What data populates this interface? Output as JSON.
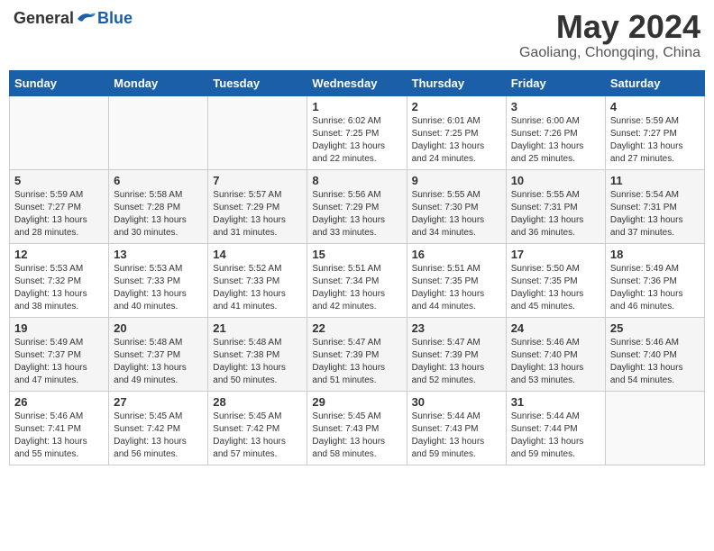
{
  "header": {
    "logo_general": "General",
    "logo_blue": "Blue",
    "month_title": "May 2024",
    "location": "Gaoliang, Chongqing, China"
  },
  "weekdays": [
    "Sunday",
    "Monday",
    "Tuesday",
    "Wednesday",
    "Thursday",
    "Friday",
    "Saturday"
  ],
  "weeks": [
    [
      {
        "day": "",
        "info": ""
      },
      {
        "day": "",
        "info": ""
      },
      {
        "day": "",
        "info": ""
      },
      {
        "day": "1",
        "info": "Sunrise: 6:02 AM\nSunset: 7:25 PM\nDaylight: 13 hours\nand 22 minutes."
      },
      {
        "day": "2",
        "info": "Sunrise: 6:01 AM\nSunset: 7:25 PM\nDaylight: 13 hours\nand 24 minutes."
      },
      {
        "day": "3",
        "info": "Sunrise: 6:00 AM\nSunset: 7:26 PM\nDaylight: 13 hours\nand 25 minutes."
      },
      {
        "day": "4",
        "info": "Sunrise: 5:59 AM\nSunset: 7:27 PM\nDaylight: 13 hours\nand 27 minutes."
      }
    ],
    [
      {
        "day": "5",
        "info": "Sunrise: 5:59 AM\nSunset: 7:27 PM\nDaylight: 13 hours\nand 28 minutes."
      },
      {
        "day": "6",
        "info": "Sunrise: 5:58 AM\nSunset: 7:28 PM\nDaylight: 13 hours\nand 30 minutes."
      },
      {
        "day": "7",
        "info": "Sunrise: 5:57 AM\nSunset: 7:29 PM\nDaylight: 13 hours\nand 31 minutes."
      },
      {
        "day": "8",
        "info": "Sunrise: 5:56 AM\nSunset: 7:29 PM\nDaylight: 13 hours\nand 33 minutes."
      },
      {
        "day": "9",
        "info": "Sunrise: 5:55 AM\nSunset: 7:30 PM\nDaylight: 13 hours\nand 34 minutes."
      },
      {
        "day": "10",
        "info": "Sunrise: 5:55 AM\nSunset: 7:31 PM\nDaylight: 13 hours\nand 36 minutes."
      },
      {
        "day": "11",
        "info": "Sunrise: 5:54 AM\nSunset: 7:31 PM\nDaylight: 13 hours\nand 37 minutes."
      }
    ],
    [
      {
        "day": "12",
        "info": "Sunrise: 5:53 AM\nSunset: 7:32 PM\nDaylight: 13 hours\nand 38 minutes."
      },
      {
        "day": "13",
        "info": "Sunrise: 5:53 AM\nSunset: 7:33 PM\nDaylight: 13 hours\nand 40 minutes."
      },
      {
        "day": "14",
        "info": "Sunrise: 5:52 AM\nSunset: 7:33 PM\nDaylight: 13 hours\nand 41 minutes."
      },
      {
        "day": "15",
        "info": "Sunrise: 5:51 AM\nSunset: 7:34 PM\nDaylight: 13 hours\nand 42 minutes."
      },
      {
        "day": "16",
        "info": "Sunrise: 5:51 AM\nSunset: 7:35 PM\nDaylight: 13 hours\nand 44 minutes."
      },
      {
        "day": "17",
        "info": "Sunrise: 5:50 AM\nSunset: 7:35 PM\nDaylight: 13 hours\nand 45 minutes."
      },
      {
        "day": "18",
        "info": "Sunrise: 5:49 AM\nSunset: 7:36 PM\nDaylight: 13 hours\nand 46 minutes."
      }
    ],
    [
      {
        "day": "19",
        "info": "Sunrise: 5:49 AM\nSunset: 7:37 PM\nDaylight: 13 hours\nand 47 minutes."
      },
      {
        "day": "20",
        "info": "Sunrise: 5:48 AM\nSunset: 7:37 PM\nDaylight: 13 hours\nand 49 minutes."
      },
      {
        "day": "21",
        "info": "Sunrise: 5:48 AM\nSunset: 7:38 PM\nDaylight: 13 hours\nand 50 minutes."
      },
      {
        "day": "22",
        "info": "Sunrise: 5:47 AM\nSunset: 7:39 PM\nDaylight: 13 hours\nand 51 minutes."
      },
      {
        "day": "23",
        "info": "Sunrise: 5:47 AM\nSunset: 7:39 PM\nDaylight: 13 hours\nand 52 minutes."
      },
      {
        "day": "24",
        "info": "Sunrise: 5:46 AM\nSunset: 7:40 PM\nDaylight: 13 hours\nand 53 minutes."
      },
      {
        "day": "25",
        "info": "Sunrise: 5:46 AM\nSunset: 7:40 PM\nDaylight: 13 hours\nand 54 minutes."
      }
    ],
    [
      {
        "day": "26",
        "info": "Sunrise: 5:46 AM\nSunset: 7:41 PM\nDaylight: 13 hours\nand 55 minutes."
      },
      {
        "day": "27",
        "info": "Sunrise: 5:45 AM\nSunset: 7:42 PM\nDaylight: 13 hours\nand 56 minutes."
      },
      {
        "day": "28",
        "info": "Sunrise: 5:45 AM\nSunset: 7:42 PM\nDaylight: 13 hours\nand 57 minutes."
      },
      {
        "day": "29",
        "info": "Sunrise: 5:45 AM\nSunset: 7:43 PM\nDaylight: 13 hours\nand 58 minutes."
      },
      {
        "day": "30",
        "info": "Sunrise: 5:44 AM\nSunset: 7:43 PM\nDaylight: 13 hours\nand 59 minutes."
      },
      {
        "day": "31",
        "info": "Sunrise: 5:44 AM\nSunset: 7:44 PM\nDaylight: 13 hours\nand 59 minutes."
      },
      {
        "day": "",
        "info": ""
      }
    ]
  ]
}
